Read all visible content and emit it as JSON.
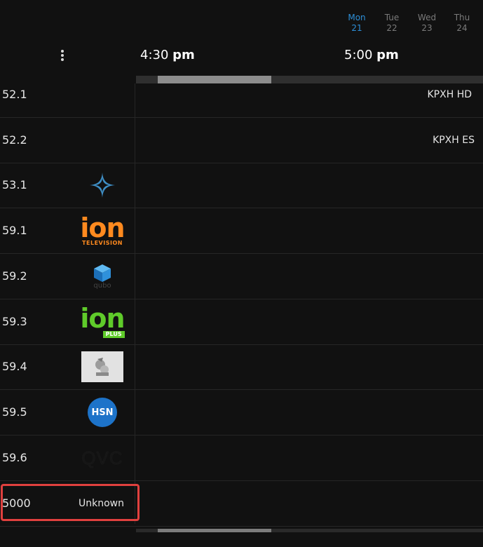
{
  "days": [
    {
      "name": "Mon",
      "date": "21",
      "active": true
    },
    {
      "name": "Tue",
      "date": "22",
      "active": false
    },
    {
      "name": "Wed",
      "date": "23",
      "active": false
    },
    {
      "name": "Thu",
      "date": "24",
      "active": false
    }
  ],
  "times": [
    {
      "hour": "4:30",
      "ampm": "pm"
    },
    {
      "hour": "5:00",
      "ampm": "pm"
    }
  ],
  "channels": [
    {
      "number": "52.1",
      "name": "KPXH HD",
      "logo": "text"
    },
    {
      "number": "52.2",
      "name": "KPXH ES",
      "logo": "text"
    },
    {
      "number": "53.1",
      "name": "",
      "logo": "star-network-logo"
    },
    {
      "number": "59.1",
      "name": "",
      "logo": "ion-television-logo",
      "logo_text": "ion",
      "logo_sub": "TELEVISION"
    },
    {
      "number": "59.2",
      "name": "",
      "logo": "qubo-logo",
      "logo_text": "qubo"
    },
    {
      "number": "59.3",
      "name": "",
      "logo": "ion-plus-logo",
      "logo_text": "ion",
      "logo_sub": "PLUS"
    },
    {
      "number": "59.4",
      "name": "",
      "logo": "image-logo"
    },
    {
      "number": "59.5",
      "name": "",
      "logo": "hsn-logo",
      "logo_text": "HSN"
    },
    {
      "number": "59.6",
      "name": "",
      "logo": "qvc-logo",
      "logo_text": "QVC"
    },
    {
      "number": "5000",
      "name": "Unknown",
      "logo": "text",
      "selected": true
    }
  ],
  "colors": {
    "accent": "#2d8fd8",
    "ion_orange": "#ff8a1f",
    "ion_green": "#5fcb2a",
    "hsn_blue": "#1d73c9",
    "selection": "#e0403e"
  }
}
